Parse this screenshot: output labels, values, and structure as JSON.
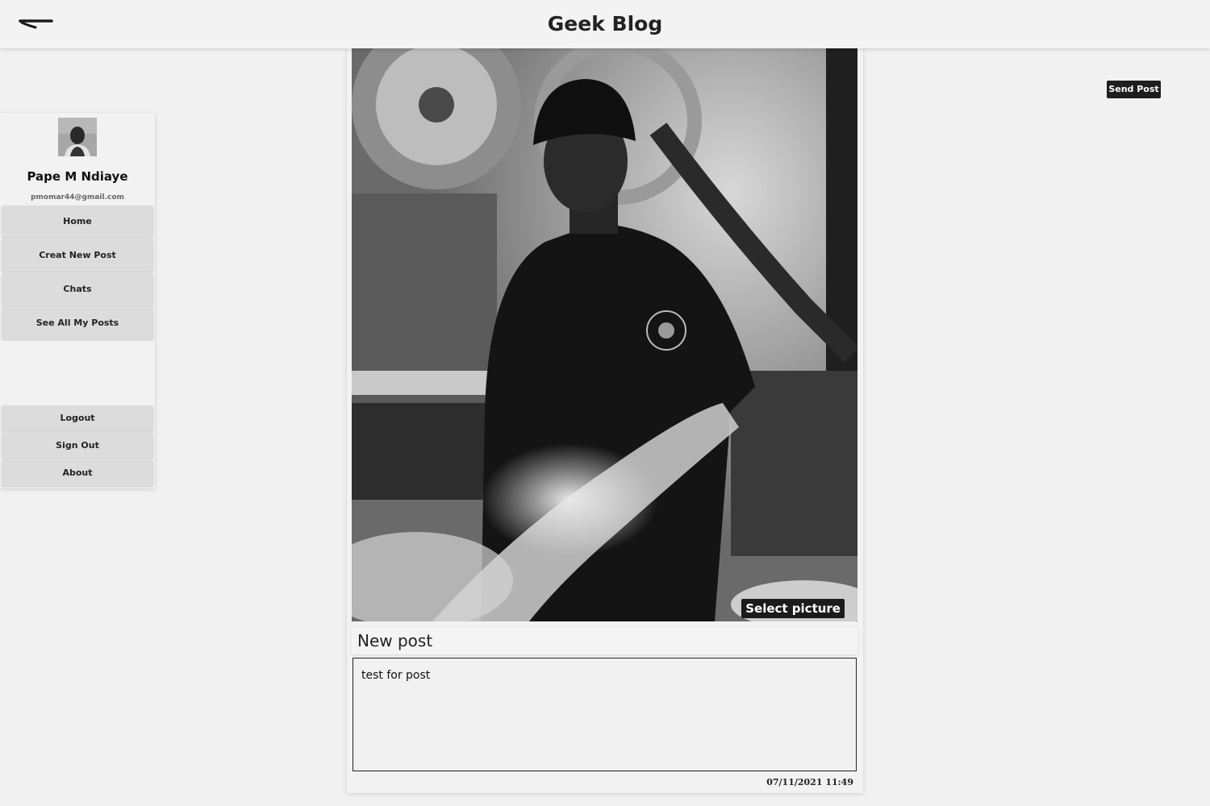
{
  "header": {
    "title": "Geek Blog",
    "menu_icon": "hamburger-swoosh-icon"
  },
  "sidebar": {
    "user_name": "Pape M Ndiaye",
    "user_email": "pmomar44@gmail.com",
    "nav_items": [
      "Home",
      "Creat New Post",
      "Chats",
      "See All My Posts"
    ],
    "footer_items": [
      "Logout",
      "Sign Out",
      "About"
    ]
  },
  "actions": {
    "send_post_label": "Send Post"
  },
  "post": {
    "select_picture_label": "Select picture",
    "heading": "New post",
    "body_value": "test for post",
    "date": "07/11/2021 11:49"
  },
  "colors": {
    "background": "#f1f1f1",
    "button_dark": "#1e1e1e",
    "nav_button": "#dcdcdc"
  }
}
